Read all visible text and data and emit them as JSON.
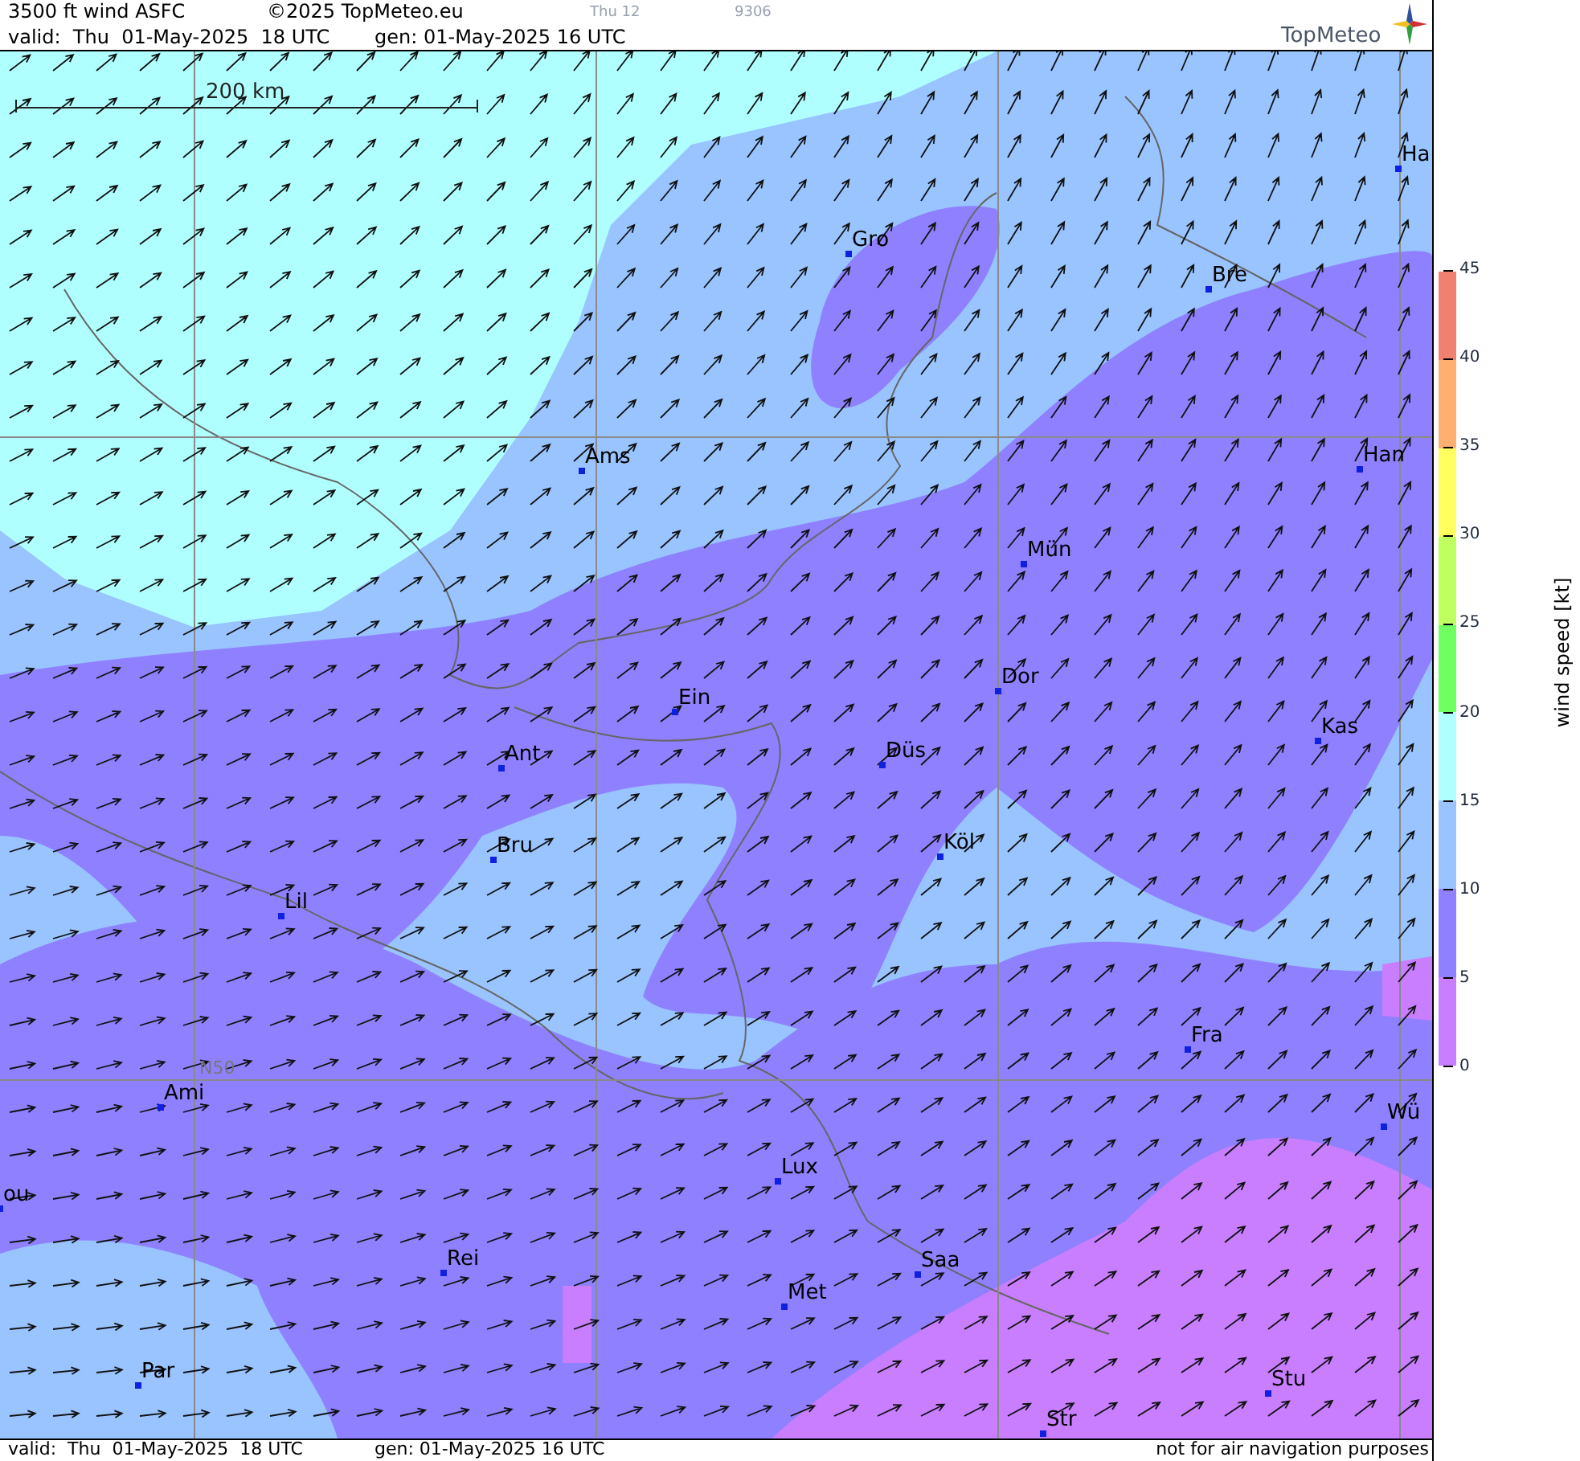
{
  "header": {
    "product": "3500 ft wind ASFC",
    "copyright": "©2025 TopMeteo.eu",
    "valid": "valid:  Thu  01-May-2025  18 UTC",
    "generated": "gen: 01-May-2025 16 UTC",
    "run_label": "Thu 12",
    "code": "9306",
    "logo": "TopMeteo"
  },
  "map": {
    "scale": "200 km",
    "gridline_label": "N50",
    "cities": [
      {
        "name": "Ha"
      },
      {
        "name": "Gro"
      },
      {
        "name": "Bre"
      },
      {
        "name": "Ams"
      },
      {
        "name": "Han"
      },
      {
        "name": "Mün"
      },
      {
        "name": "Dor"
      },
      {
        "name": "Ein"
      },
      {
        "name": "Kas"
      },
      {
        "name": "Düs"
      },
      {
        "name": "Ant"
      },
      {
        "name": "Köl"
      },
      {
        "name": "Bru"
      },
      {
        "name": "Lil"
      },
      {
        "name": "Fra"
      },
      {
        "name": "Ami"
      },
      {
        "name": "Wü"
      },
      {
        "name": "Lux"
      },
      {
        "name": "ou"
      },
      {
        "name": "Rei"
      },
      {
        "name": "Saa"
      },
      {
        "name": "Met"
      },
      {
        "name": "Par"
      },
      {
        "name": "Stu"
      },
      {
        "name": "Str"
      }
    ]
  },
  "legend": {
    "title": "wind speed [kt]",
    "ticks": [
      "45",
      "40",
      "35",
      "30",
      "25",
      "20",
      "15",
      "10",
      "5",
      "0"
    ],
    "bands": [
      {
        "color": "#f08070"
      },
      {
        "color": "#ffb070"
      },
      {
        "color": "#ffff60"
      },
      {
        "color": "#c0ff60"
      },
      {
        "color": "#70ff60"
      },
      {
        "color": "#b0ffff"
      },
      {
        "color": "#99c4ff"
      },
      {
        "color": "#8f80ff"
      },
      {
        "color": "#c87eff"
      }
    ]
  },
  "footer": {
    "valid": "valid:  Thu  01-May-2025  18 UTC",
    "generated": "gen: 01-May-2025 16 UTC",
    "disclaimer": "not for air navigation purposes"
  }
}
